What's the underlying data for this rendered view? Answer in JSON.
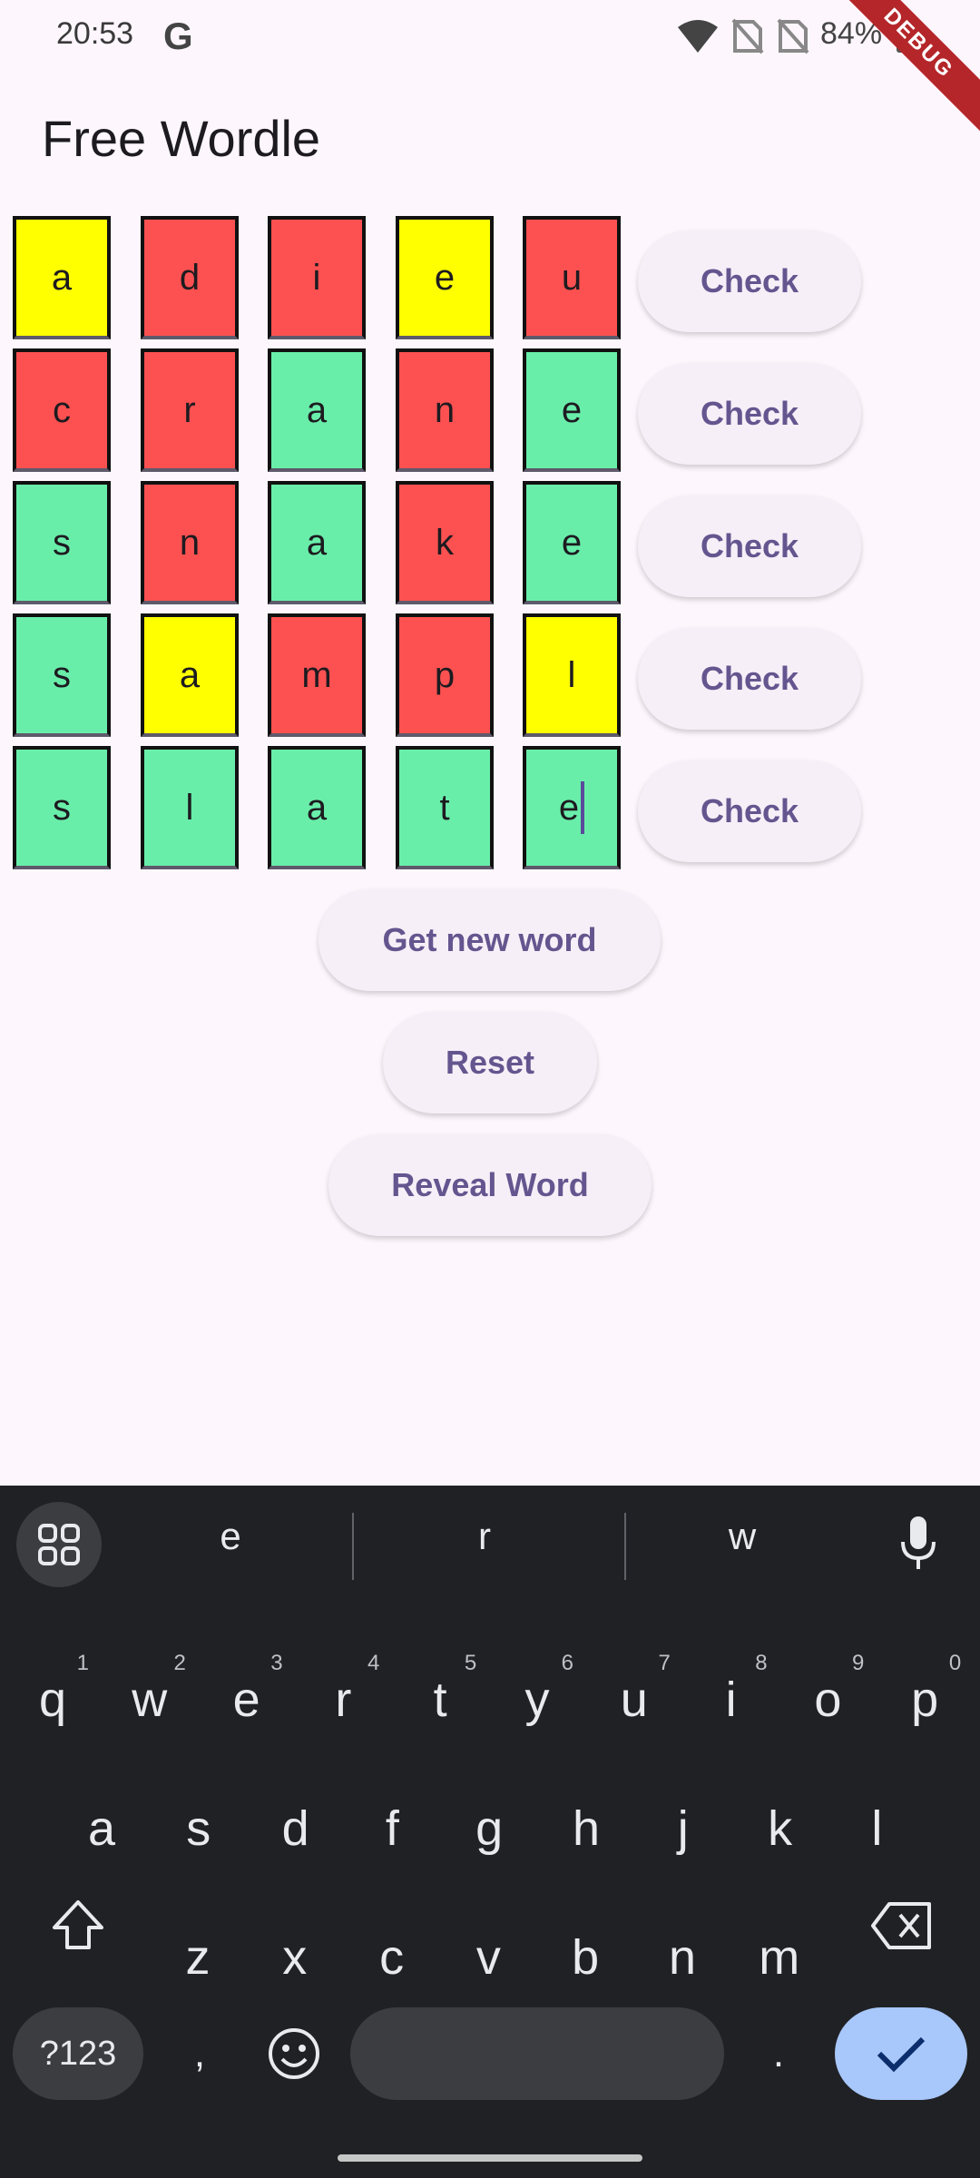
{
  "status_bar": {
    "time": "20:53",
    "g_label": "G",
    "battery": "84%",
    "debug_label": "DEBUG"
  },
  "app": {
    "title": "Free Wordle"
  },
  "grid": {
    "colors": {
      "green": "#69eeaa",
      "red": "#fd5151",
      "yellow": "#ffff00"
    },
    "rows": [
      {
        "check_label": "Check",
        "letters": [
          "a",
          "d",
          "i",
          "e",
          "u"
        ],
        "states": [
          "yellow",
          "red",
          "red",
          "yellow",
          "red"
        ]
      },
      {
        "check_label": "Check",
        "letters": [
          "c",
          "r",
          "a",
          "n",
          "e"
        ],
        "states": [
          "red",
          "red",
          "green",
          "red",
          "green"
        ]
      },
      {
        "check_label": "Check",
        "letters": [
          "s",
          "n",
          "a",
          "k",
          "e"
        ],
        "states": [
          "green",
          "red",
          "green",
          "red",
          "green"
        ]
      },
      {
        "check_label": "Check",
        "letters": [
          "s",
          "a",
          "m",
          "p",
          "l"
        ],
        "states": [
          "green",
          "yellow",
          "red",
          "red",
          "yellow"
        ]
      },
      {
        "check_label": "Check",
        "letters": [
          "s",
          "l",
          "a",
          "t",
          "e"
        ],
        "states": [
          "green",
          "green",
          "green",
          "green",
          "green"
        ]
      }
    ]
  },
  "actions": {
    "new_word": "Get new word",
    "reset": "Reset",
    "reveal": "Reveal Word"
  },
  "keyboard": {
    "suggestions": [
      "e",
      "r",
      "w"
    ],
    "row1": [
      {
        "k": "q",
        "h": "1"
      },
      {
        "k": "w",
        "h": "2"
      },
      {
        "k": "e",
        "h": "3"
      },
      {
        "k": "r",
        "h": "4"
      },
      {
        "k": "t",
        "h": "5"
      },
      {
        "k": "y",
        "h": "6"
      },
      {
        "k": "u",
        "h": "7"
      },
      {
        "k": "i",
        "h": "8"
      },
      {
        "k": "o",
        "h": "9"
      },
      {
        "k": "p",
        "h": "0"
      }
    ],
    "row2": [
      "a",
      "s",
      "d",
      "f",
      "g",
      "h",
      "j",
      "k",
      "l"
    ],
    "row3": [
      "z",
      "x",
      "c",
      "v",
      "b",
      "n",
      "m"
    ],
    "symbols_label": "?123",
    "comma_label": ",",
    "period_label": "."
  }
}
